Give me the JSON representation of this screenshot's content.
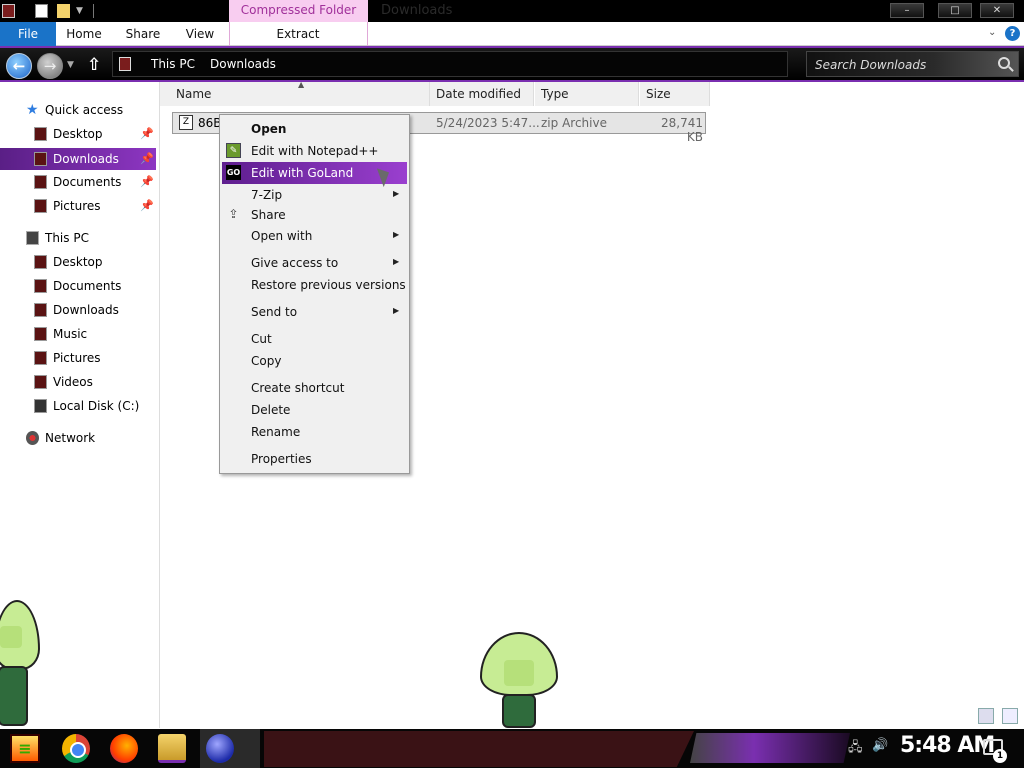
{
  "titlebar": {
    "context_tab": "Compressed Folder Tools",
    "window_title": "Downloads",
    "min_label": "–",
    "max_label": "□",
    "close_label": "✕"
  },
  "ribbon": {
    "tabs": [
      "File",
      "Home",
      "Share",
      "View",
      "Extract"
    ],
    "collapse_label": "⌄",
    "help_label": "?"
  },
  "address": {
    "crumbs": [
      "This PC",
      "Downloads"
    ],
    "search_placeholder": "Search Downloads"
  },
  "nav": {
    "items": [
      {
        "label": "Quick access",
        "icon": "star-icon"
      },
      {
        "label": "Desktop",
        "icon": "desktop-icon",
        "pinned": true
      },
      {
        "label": "Downloads",
        "icon": "downloads-icon",
        "pinned": true,
        "selected": true
      },
      {
        "label": "Documents",
        "icon": "documents-icon",
        "pinned": true
      },
      {
        "label": "Pictures",
        "icon": "pictures-icon",
        "pinned": true
      },
      {
        "label": "This PC",
        "icon": "computer-icon"
      },
      {
        "label": "Desktop",
        "icon": "desktop-icon"
      },
      {
        "label": "Documents",
        "icon": "documents-icon"
      },
      {
        "label": "Downloads",
        "icon": "downloads-icon"
      },
      {
        "label": "Music",
        "icon": "music-icon"
      },
      {
        "label": "Pictures",
        "icon": "pictures-icon"
      },
      {
        "label": "Videos",
        "icon": "videos-icon"
      },
      {
        "label": "Local Disk (C:)",
        "icon": "disk-icon"
      },
      {
        "label": "Network",
        "icon": "network-icon"
      }
    ]
  },
  "columns": [
    "Name",
    "Date modified",
    "Type",
    "Size"
  ],
  "file": {
    "name": "86Bc",
    "date": "5/24/2023 5:47...",
    "type": "zip Archive",
    "size": "28,741 KB"
  },
  "context_menu": {
    "items": [
      {
        "label": "Open",
        "bold": true
      },
      {
        "label": "Edit with Notepad++",
        "icon": "notepadpp-icon"
      },
      {
        "label": "Edit with GoLand",
        "icon": "goland-icon",
        "highlighted": true
      },
      {
        "label": "7-Zip",
        "submenu": true
      },
      {
        "label": "Share",
        "icon": "share-icon"
      },
      {
        "label": "Open with",
        "submenu": true
      },
      {
        "label": "Give access to",
        "submenu": true
      },
      {
        "label": "Restore previous versions"
      },
      {
        "label": "Send to",
        "submenu": true
      },
      {
        "label": "Cut"
      },
      {
        "label": "Copy"
      },
      {
        "label": "Create shortcut"
      },
      {
        "label": "Delete"
      },
      {
        "label": "Rename"
      },
      {
        "label": "Properties"
      }
    ],
    "goland_icon_text": "GO",
    "submenu_arrow": "▶"
  },
  "taskbar": {
    "apps": [
      "chrome-icon",
      "firefox-icon",
      "file-explorer-icon",
      "app-ball-icon"
    ],
    "clock": "5:48 AM",
    "notification_count": "1"
  },
  "colors": {
    "accent_purple": "#7a2fb0",
    "file_tab_blue": "#1a73c8",
    "context_tab_pink": "#f8cdf0"
  }
}
